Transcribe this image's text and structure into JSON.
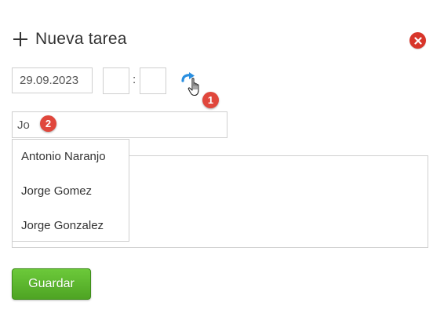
{
  "header": {
    "title": "Nueva tarea",
    "add_icon": "plus-icon",
    "close_icon": "close-icon"
  },
  "form": {
    "date_value": "29.09.2023",
    "hour_value": "",
    "minute_value": "",
    "time_separator": ":",
    "refresh_icon": "refresh-icon",
    "assignee_value": "Jo",
    "description_value": ""
  },
  "suggestions": [
    "Antonio Naranjo",
    "Jorge Gomez",
    "Jorge Gonzalez"
  ],
  "badges": {
    "step1": "1",
    "step2": "2"
  },
  "actions": {
    "save_label": "Guardar"
  },
  "colors": {
    "accent_green": "#5bb52c",
    "close_red": "#d8352a",
    "badge_red": "#e0473c",
    "refresh_blue": "#2a8fe0"
  }
}
